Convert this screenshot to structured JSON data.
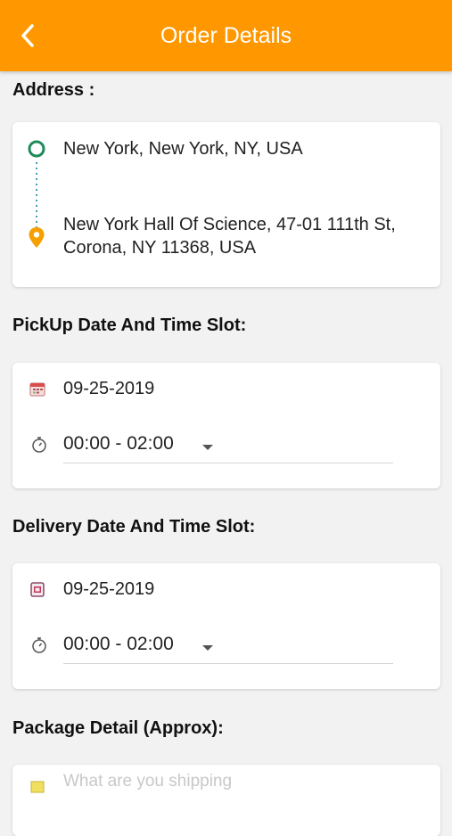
{
  "header": {
    "title": "Order Details",
    "back_icon": "chevron-left-icon",
    "background": "#ff9800"
  },
  "address": {
    "label": "Address :",
    "pickup": "New York, New York, NY, USA",
    "dropoff_line1": "New York Hall Of Science, 47-01 111th St,",
    "dropoff_line2": "Corona, NY 11368, USA",
    "origin_icon": "circle-outline-icon",
    "destination_icon": "map-pin-icon",
    "origin_color": "#1e8a5a",
    "destination_color": "#f5a000"
  },
  "pickup_slot": {
    "label": "PickUp Date And Time Slot:",
    "date": "09-25-2019",
    "time": "00:00 - 02:00",
    "date_icon": "calendar-icon",
    "time_icon": "stopwatch-icon"
  },
  "delivery_slot": {
    "label": "Delivery Date And Time Slot:",
    "date": "09-25-2019",
    "time": "00:00 - 02:00",
    "date_icon": "calendar-icon",
    "time_icon": "stopwatch-icon"
  },
  "package": {
    "label": "Package Detail (Approx):",
    "placeholder": "What are you shipping"
  }
}
